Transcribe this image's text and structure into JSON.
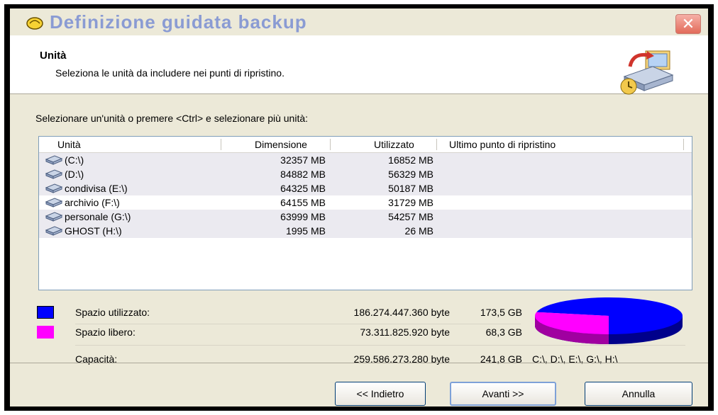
{
  "window": {
    "title": "Definizione guidata backup",
    "close_label": "✕"
  },
  "header": {
    "title": "Unità",
    "subtitle": "Seleziona le unità da includere nei punti di ripristino."
  },
  "instruction": "Selezionare un'unità o premere <Ctrl> e selezionare più unità:",
  "table": {
    "columns": [
      "Unità",
      "Dimensione",
      "Utilizzato",
      "Ultimo punto di ripristino"
    ],
    "rows": [
      {
        "name": "(C:\\)",
        "size": "32357 MB",
        "used": "16852 MB",
        "last": ""
      },
      {
        "name": "(D:\\)",
        "size": "84882 MB",
        "used": "56329 MB",
        "last": ""
      },
      {
        "name": "condivisa (E:\\)",
        "size": "64325 MB",
        "used": "50187 MB",
        "last": ""
      },
      {
        "name": "archivio (F:\\)",
        "size": "64155 MB",
        "used": "31729 MB",
        "last": ""
      },
      {
        "name": "personale (G:\\)",
        "size": "63999 MB",
        "used": "54257 MB",
        "last": ""
      },
      {
        "name": "GHOST (H:\\)",
        "size": "1995 MB",
        "used": "26 MB",
        "last": ""
      }
    ]
  },
  "summary": {
    "used_label": "Spazio utilizzato:",
    "used_bytes": "186.274.447.360 byte",
    "used_gb": "173,5 GB",
    "used_color": "#0000ff",
    "free_label": "Spazio libero:",
    "free_bytes": "73.311.825.920 byte",
    "free_gb": "68,3 GB",
    "free_color": "#ff00ff",
    "capacity_label": "Capacità:",
    "capacity_bytes": "259.586.273.280 byte",
    "capacity_gb": "241,8 GB",
    "capacity_drives": "C:\\, D:\\, E:\\, G:\\, H:\\",
    "used_fraction": 0.7176
  },
  "buttons": {
    "back": "<< Indietro",
    "next": "Avanti >>",
    "cancel": "Annulla"
  }
}
